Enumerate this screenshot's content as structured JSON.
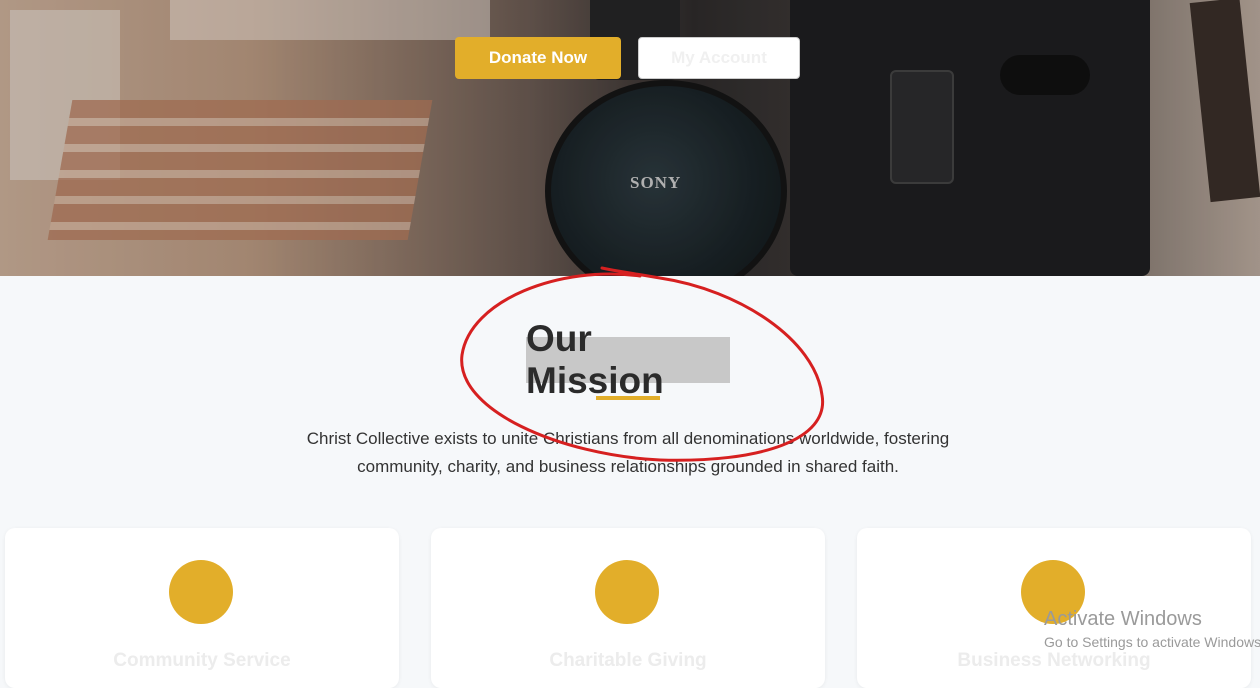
{
  "hero": {
    "donate_label": "Donate Now",
    "account_label": "My Account",
    "headphone_brand": "SONY",
    "accent_color": "#e2ae2a"
  },
  "mission": {
    "title": "Our Mission",
    "line1": "Christ Collective exists to unite Christians from all denominations worldwide, fostering",
    "line2": "community, charity, and business relationships grounded in shared faith."
  },
  "cards": [
    {
      "title": "Community Service",
      "icon": "circle-icon"
    },
    {
      "title": "Charitable Giving",
      "icon": "circle-icon"
    },
    {
      "title": "Business Networking",
      "icon": "circle-icon"
    }
  ],
  "watermark": {
    "title": "Activate Windows",
    "subtitle": "Go to Settings to activate Windows."
  }
}
